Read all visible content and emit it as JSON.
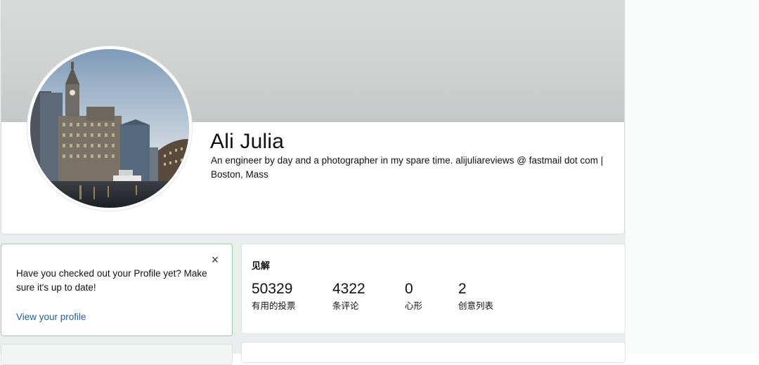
{
  "profile": {
    "name": "Ali Julia",
    "bio": "An engineer by day and a photographer in my spare time. alijuliareviews @ fastmail dot com | Boston, Mass",
    "avatar_icon": "avatar-photo-boston-skyline"
  },
  "notice": {
    "text": "Have you checked out your Profile yet? Make sure it's up to date!",
    "link_label": "View your profile",
    "close_glyph": "×",
    "close_icon": "close-icon"
  },
  "insights": {
    "title": "见解",
    "stats": [
      {
        "value": "50329",
        "label": "有用的投票"
      },
      {
        "value": "4322",
        "label": "条评论"
      },
      {
        "value": "0",
        "label": "心形"
      },
      {
        "value": "2",
        "label": "创意列表"
      }
    ]
  },
  "colors": {
    "link": "#2162a1",
    "notice_border": "#9ed0a6",
    "page_background": "#eaeded"
  }
}
